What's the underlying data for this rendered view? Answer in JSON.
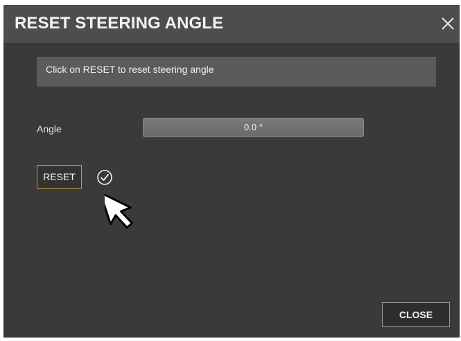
{
  "dialog": {
    "title": "RESET STEERING ANGLE",
    "info_text": "Click on RESET to reset steering angle",
    "angle_label": "Angle",
    "angle_value": "0.0 °",
    "reset_label": "RESET",
    "close_label": "CLOSE",
    "status_icon": "check-circle-icon",
    "close_icon": "close-icon",
    "cursor_icon": "mouse-pointer-icon"
  },
  "colors": {
    "background": "#3a3a3a",
    "titlebar": "#4d4d4d",
    "banner": "#5b5b5b",
    "reset_border": "#c9a227",
    "text": "#f2f2f2"
  }
}
